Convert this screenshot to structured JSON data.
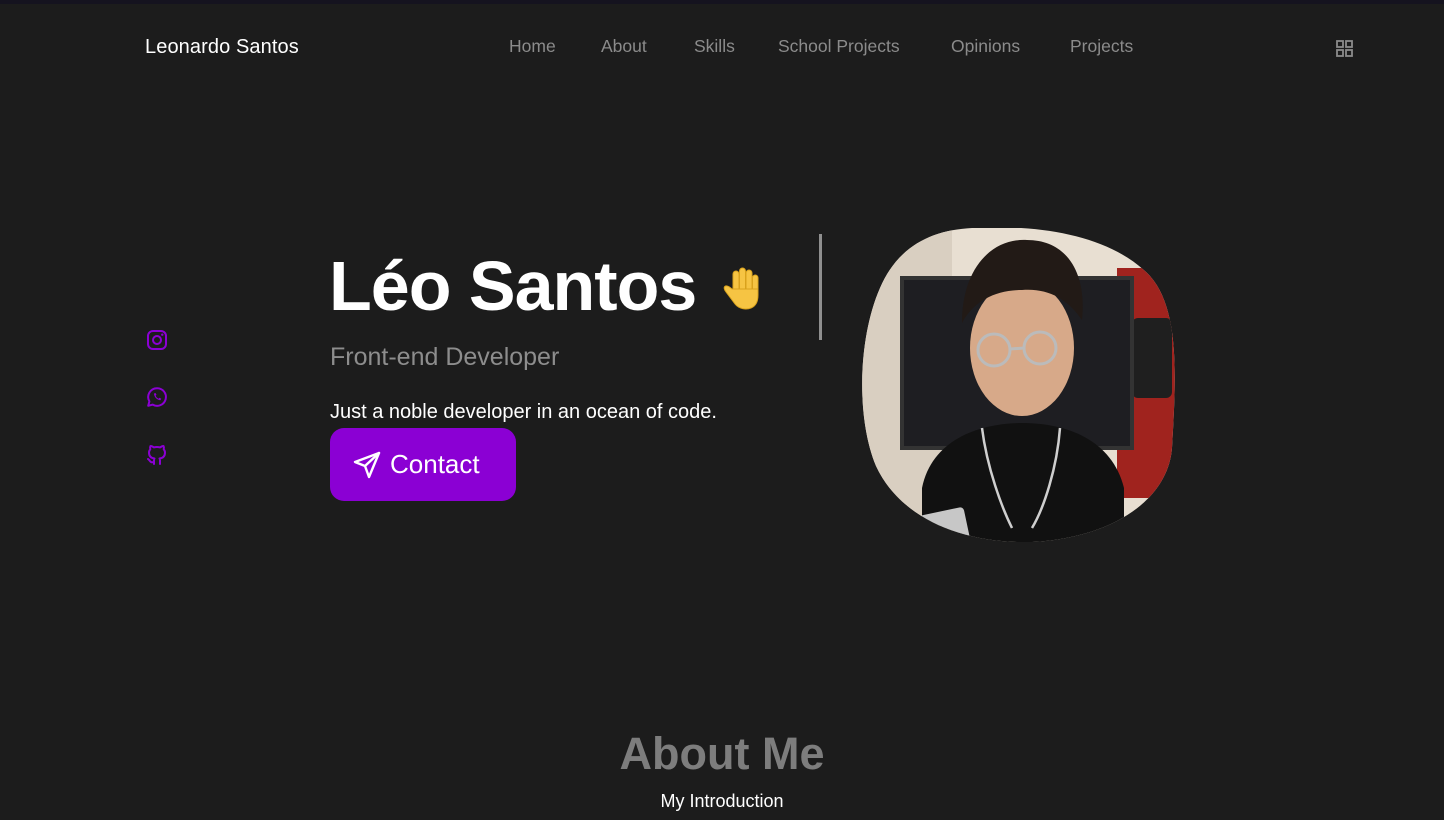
{
  "header": {
    "brand": "Leonardo Santos",
    "nav": [
      "Home",
      "About",
      "Skills",
      "School Projects",
      "Opinions",
      "Projects"
    ],
    "menu_icon": "grid-menu-icon"
  },
  "socials": [
    {
      "name": "instagram-icon"
    },
    {
      "name": "whatsapp-icon"
    },
    {
      "name": "github-icon"
    }
  ],
  "hero": {
    "name": "Léo Santos",
    "wave_icon": "waving-hand-icon",
    "subtitle": "Front-end Developer",
    "tagline": "Just a noble developer in an ocean of code.",
    "contact_label": "Contact",
    "contact_icon": "send-icon"
  },
  "about": {
    "title": "About Me",
    "subtitle": "My Introduction"
  },
  "colors": {
    "background": "#1c1c1c",
    "accent": "#8b00d4",
    "nav_text": "#8b8b8b",
    "muted": "#8d8d8d"
  }
}
